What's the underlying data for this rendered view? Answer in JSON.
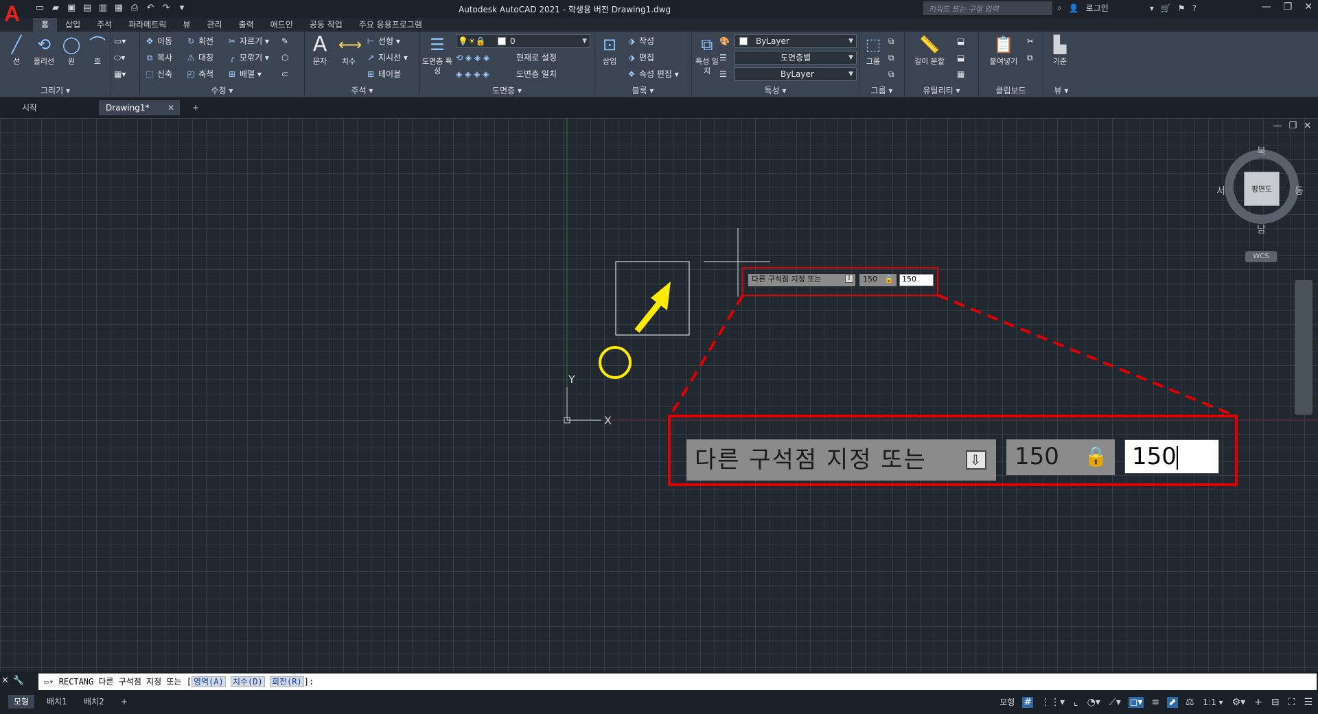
{
  "titlebar": {
    "title": "Autodesk AutoCAD 2021 - 학생용 버전    Drawing1.dwg",
    "search_placeholder": "키워드 또는 구절 입력",
    "login_label": "로그인"
  },
  "ribbon_tabs": [
    "홈",
    "삽입",
    "주석",
    "파라메트릭",
    "뷰",
    "관리",
    "출력",
    "애드인",
    "공동 작업",
    "주요 응용프로그램"
  ],
  "ribbon": {
    "draw": {
      "title": "그리기 ▾",
      "line": "선",
      "polyline": "폴리선",
      "circle": "원",
      "arc": "호"
    },
    "modify": {
      "title": "수정 ▾",
      "move": "이동",
      "rotate": "회전",
      "trim": "자르기 ▾",
      "copy": "복사",
      "mirror": "대칭",
      "fillet": "모깎기 ▾",
      "stretch": "신축",
      "scale": "축척",
      "array": "배열 ▾"
    },
    "annotation": {
      "title": "주석 ▾",
      "text": "문자",
      "dimension": "치수",
      "linear": "선형 ▾",
      "leader": "지시선 ▾",
      "table": "테이블"
    },
    "layers": {
      "title": "도면층 ▾",
      "layer_props": "도면층 특성",
      "current_layer": "0",
      "set_current": "현재로 설정",
      "match_layer": "도면층 일치"
    },
    "block": {
      "title": "블록 ▾",
      "insert": "삽입",
      "create": "작성",
      "edit": "편집",
      "edit_attr": "속성 편집 ▾"
    },
    "properties": {
      "title": "특성 ▾",
      "match": "특성 일치",
      "color": "ByLayer",
      "linetype": "도면층별",
      "lineweight": "ByLayer"
    },
    "groups": {
      "title": "그룹 ▾",
      "group": "그룹"
    },
    "utilities": {
      "title": "유틸리티 ▾",
      "measure": "길이 분할"
    },
    "clipboard": {
      "title": "클립보드",
      "paste": "붙여넣기"
    },
    "view": {
      "title": "뷰 ▾",
      "base": "기준"
    }
  },
  "file_tabs": {
    "start": "시작",
    "drawing": "Drawing1*"
  },
  "viewport": {
    "controls": [
      "—",
      "❐",
      "✕"
    ],
    "ucs_y": "Y",
    "ucs_x": "X",
    "dynamic_input": {
      "prompt": "다른 구석점 지정 또는",
      "value_locked": "150",
      "value_active": "150"
    },
    "viewcube": {
      "north": "북",
      "south": "남",
      "east": "동",
      "west": "서",
      "face": "평면도",
      "wcs": "WCS"
    }
  },
  "command_line": {
    "prefix": "RECTANG 다른 구석점 지정 또는 [",
    "options": [
      "영역(A)",
      "치수(D)",
      "회전(R)"
    ],
    "suffix": "]:"
  },
  "layout_tabs": [
    "모형",
    "배치1",
    "배치2",
    "+"
  ],
  "statusbar": {
    "model": "모형",
    "scale": "1:1 ▾"
  }
}
